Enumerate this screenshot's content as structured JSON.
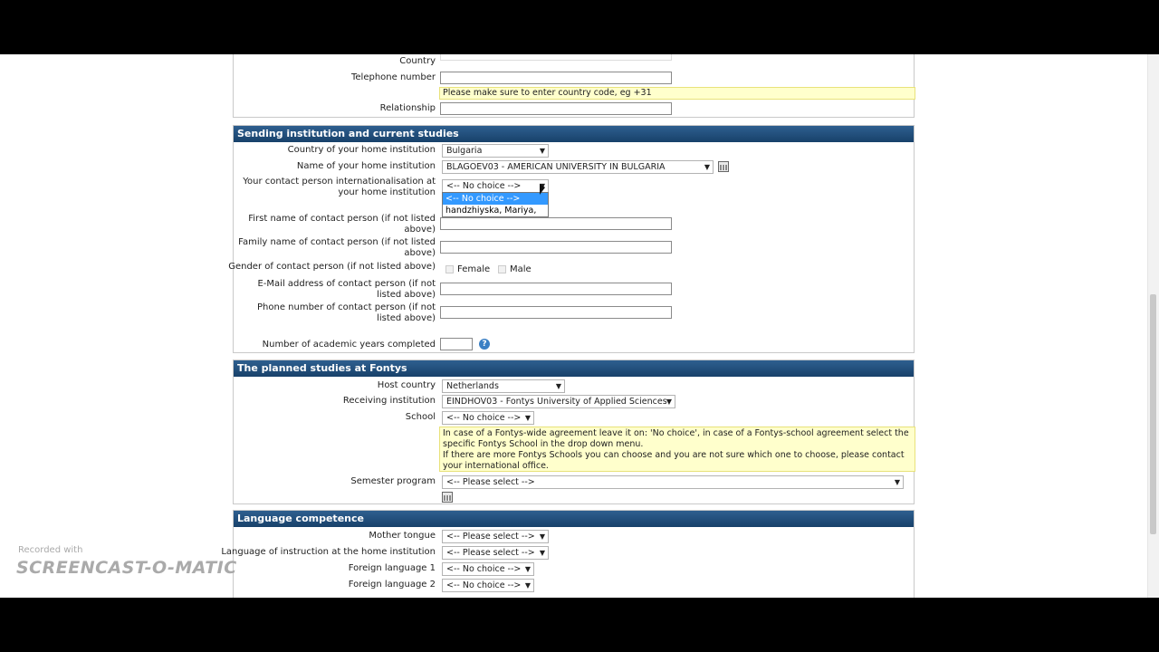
{
  "top_section": {
    "country_label": "Country",
    "telephone_label": "Telephone number",
    "telephone_note": "Please make sure to enter country code, eg +31",
    "relationship_label": "Relationship"
  },
  "sending": {
    "title": "Sending institution and current studies",
    "country_label": "Country of your home institution",
    "country_value": "Bulgaria",
    "institution_label": "Name of your home institution",
    "institution_value": "BLAGOEV03 - AMERICAN UNIVERSITY IN BULGARIA",
    "contact_label": "Your contact person internationalisation at your home institution",
    "contact_value": "<-- No choice -->",
    "contact_options": [
      "<-- No choice -->",
      "handzhiyska, Mariya,"
    ],
    "first_name_label": "First name of contact person (if not listed above)",
    "family_name_label": "Family name of contact person (if not listed above)",
    "gender_label": "Gender of contact person (if not listed above)",
    "gender_female": "Female",
    "gender_male": "Male",
    "email_label": "E-Mail address of contact person (if not listed above)",
    "phone_label": "Phone number of contact person (if not listed above)",
    "years_label": "Number of academic years completed"
  },
  "planned": {
    "title": "The planned studies at Fontys",
    "host_label": "Host country",
    "host_value": "Netherlands",
    "receiving_label": "Receiving institution",
    "receiving_value": "EINDHOV03 - Fontys University of Applied Sciences",
    "school_label": "School",
    "school_value": "<-- No choice -->",
    "school_note_1": "In case of a Fontys-wide agreement leave it on: 'No choice', in case of a Fontys-school agreement select the specific Fontys School in the drop down menu.",
    "school_note_2": "If there are more Fontys Schools you can choose and you are not sure which one to choose, please contact your international office.",
    "semester_label": "Semester program",
    "semester_value": "<-- Please select -->"
  },
  "language": {
    "title": "Language competence",
    "mother_label": "Mother tongue",
    "mother_value": "<-- Please select -->",
    "instruction_label": "Language of instruction at the home institution",
    "instruction_value": "<-- Please select -->",
    "foreign1_label": "Foreign language 1",
    "foreign1_value": "<-- No choice -->",
    "foreign2_label": "Foreign language 2",
    "foreign2_value": "<-- No choice -->"
  },
  "watermark": {
    "small": "Recorded with",
    "big": "SCREENCAST-O-MATIC"
  },
  "colors": {
    "header_blue": "#18416a",
    "note_yellow": "#ffffcc",
    "selection_blue": "#3399ff"
  }
}
